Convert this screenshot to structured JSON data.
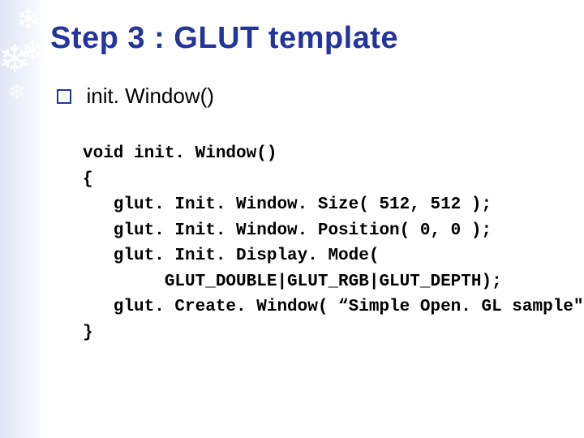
{
  "decor": {
    "sf1": "❄",
    "sf2": "❄",
    "sf3": "❄",
    "sf4": "❄"
  },
  "title": "Step 3 : GLUT template",
  "bullet": {
    "label": "init. Window()"
  },
  "code": "void init. Window()\n{\n   glut. Init. Window. Size( 512, 512 );\n   glut. Init. Window. Position( 0, 0 );\n   glut. Init. Display. Mode(\n        GLUT_DOUBLE|GLUT_RGB|GLUT_DEPTH);\n   glut. Create. Window( “Simple Open. GL sample\" );\n}"
}
